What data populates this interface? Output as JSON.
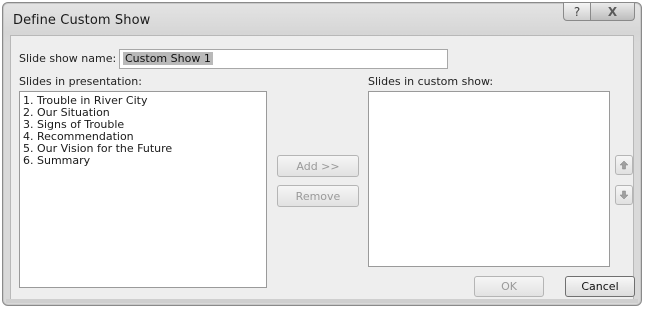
{
  "window": {
    "title": "Define Custom Show",
    "help_glyph": "?",
    "close_glyph": "X"
  },
  "form": {
    "name_label": "Slide show name:",
    "name_value": "Custom Show 1"
  },
  "presentation": {
    "label": "Slides in presentation:",
    "items": [
      "1. Trouble in River City",
      "2. Our Situation",
      "3. Signs of Trouble",
      "4. Recommendation",
      "5. Our Vision for the Future",
      "6. Summary"
    ]
  },
  "custom_show": {
    "label": "Slides in custom show:",
    "items": []
  },
  "buttons": {
    "add": "Add >>",
    "remove": "Remove",
    "ok": "OK",
    "cancel": "Cancel"
  },
  "icons": {
    "move_up": "up-arrow-icon",
    "move_down": "down-arrow-icon",
    "help": "help-icon",
    "close": "close-icon"
  }
}
